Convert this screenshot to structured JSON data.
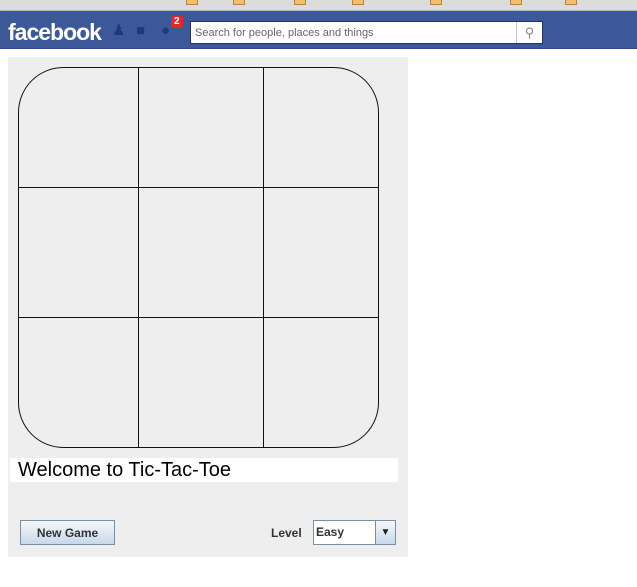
{
  "header": {
    "logo": "facebook",
    "notifications_count": "2",
    "search_placeholder": "Search for people, places and things"
  },
  "game": {
    "cells": [
      "",
      "",
      "",
      "",
      "",
      "",
      "",
      "",
      ""
    ],
    "status": "Welcome to Tic-Tac-Toe",
    "new_game_label": "New Game",
    "level_label": "Level",
    "level_value": "Easy"
  },
  "colors": {
    "brand": "#3b5998",
    "panel": "#eeeeee"
  }
}
